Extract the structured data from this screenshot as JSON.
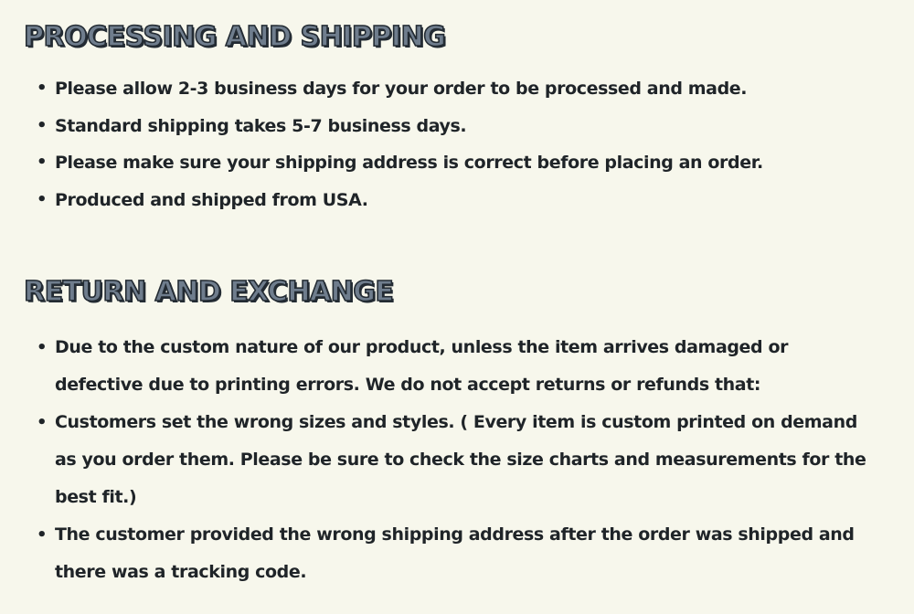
{
  "sections": [
    {
      "heading": "PROCESSING AND SHIPPING",
      "items": [
        "Please allow 2-3 business days for your order to be processed and made.",
        "Standard shipping takes 5-7 business days.",
        "Please make sure your shipping address is correct before placing an order.",
        "Produced and shipped from USA."
      ]
    },
    {
      "heading": "RETURN AND EXCHANGE",
      "items": [
        "Due to the custom nature of our product, unless the item arrives damaged or defective due to printing errors. We do not accept returns or refunds that:",
        "Customers set the wrong sizes and styles. ( Every item is custom printed on demand as you order them. Please be sure to check the size charts and measurements for the best fit.)",
        "The customer provided the wrong shipping address after the order was shipped and there was a tracking code."
      ]
    }
  ],
  "bullet_glyph": "•",
  "colors": {
    "background": "#f7f7ec",
    "text": "#1f2428",
    "heading_fill": "#6f7d8d",
    "heading_outline": "#232b33"
  }
}
